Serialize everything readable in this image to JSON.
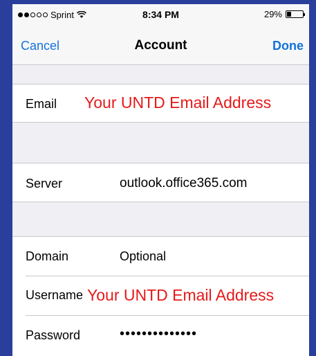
{
  "status_bar": {
    "carrier": "Sprint",
    "signal_bars_filled": 2,
    "signal_bars_total": 5,
    "time": "8:34 PM",
    "battery_percent": "29%",
    "battery_level": 0.29
  },
  "nav": {
    "cancel_label": "Cancel",
    "title": "Account",
    "done_label": "Done"
  },
  "fields": {
    "email": {
      "label": "Email",
      "annotation": "Your UNTD Email Address"
    },
    "server": {
      "label": "Server",
      "value": "outlook.office365.com"
    },
    "domain": {
      "label": "Domain",
      "placeholder": "Optional"
    },
    "username": {
      "label": "Username",
      "annotation": "Your UNTD Email Address"
    },
    "password": {
      "label": "Password",
      "value": "••••••••••••••"
    }
  },
  "colors": {
    "background_frame": "#2a3f9c",
    "ios_blue": "#1273d9",
    "annotation_red": "#e51a1a"
  }
}
